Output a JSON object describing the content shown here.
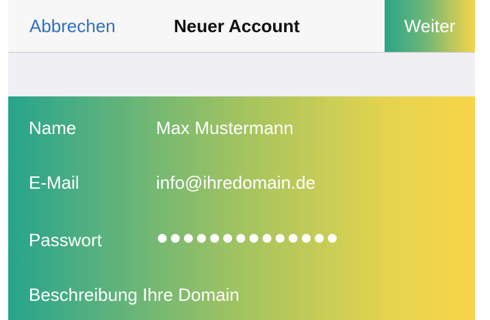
{
  "navbar": {
    "cancel_label": "Abbrechen",
    "title": "Neuer Account",
    "next_label": "Weiter"
  },
  "form": {
    "fields": [
      {
        "label": "Name",
        "value": "Max Mustermann"
      },
      {
        "label": "E-Mail",
        "value": "info@ihredomain.de"
      },
      {
        "label": "Passwort",
        "value": "●●●●●●●●●●●●●●"
      }
    ],
    "description_value": "Beschreibung Ihre Domain"
  },
  "colors": {
    "accent_link": "#2f6fbf",
    "gradient_start": "#26a48d",
    "gradient_end": "#f8d548",
    "navbar_bg": "#f7f7f7",
    "spacer_bg": "#efeff4"
  }
}
